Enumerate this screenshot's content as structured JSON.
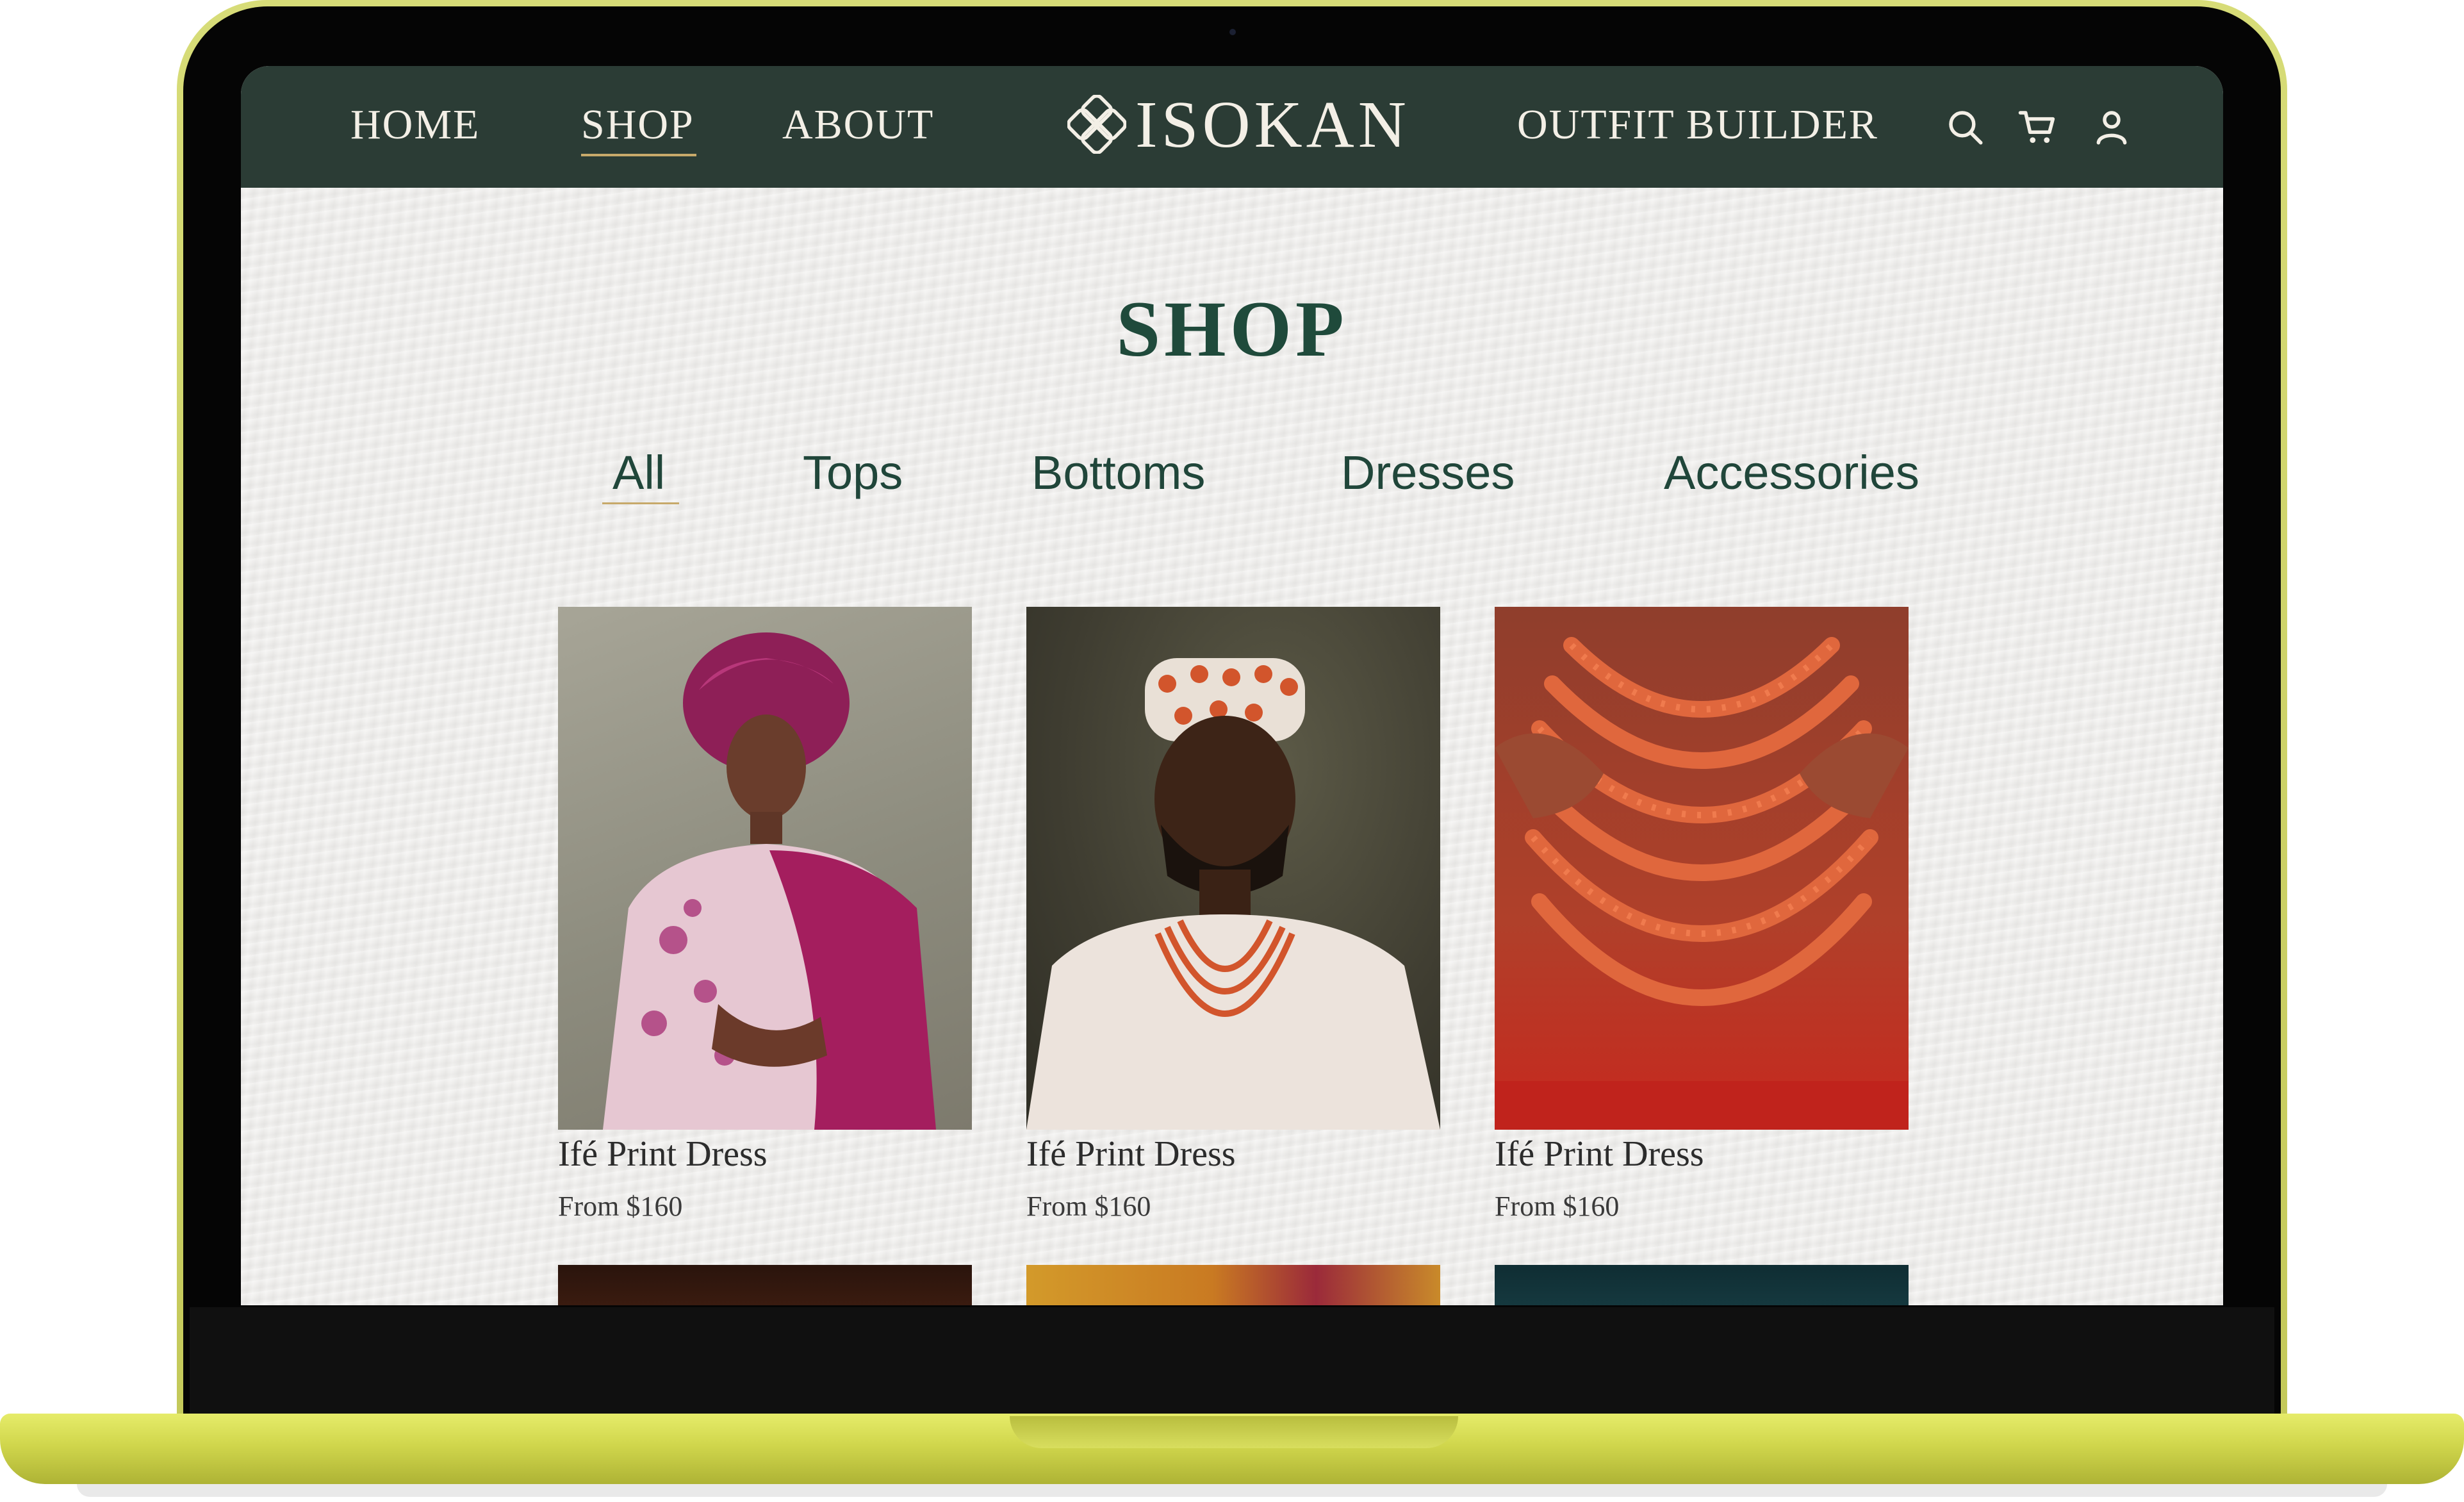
{
  "nav": {
    "home": "HOME",
    "shop": "SHOP",
    "about": "ABOUT",
    "outfit_builder": "OUTFIT BUILDER",
    "icons": [
      "search-icon",
      "cart-icon",
      "user-icon"
    ]
  },
  "brand": {
    "name": "ISOKAN",
    "logo_icon": "knot-logo-icon"
  },
  "page": {
    "title": "SHOP"
  },
  "categories": [
    "All",
    "Tops",
    "Bottoms",
    "Dresses",
    "Accessories"
  ],
  "active_category": "All",
  "products": [
    {
      "name": "Ifé Print Dress",
      "price": "From $160"
    },
    {
      "name": "Ifé Print Dress",
      "price": "From $160"
    },
    {
      "name": "Ifé Print Dress",
      "price": "From $160"
    }
  ],
  "colors": {
    "nav_bg": "#2b3c35",
    "accent_gold": "#c7a96a",
    "title_green": "#1f4a3b",
    "laptop_body": "#d0d64c"
  }
}
